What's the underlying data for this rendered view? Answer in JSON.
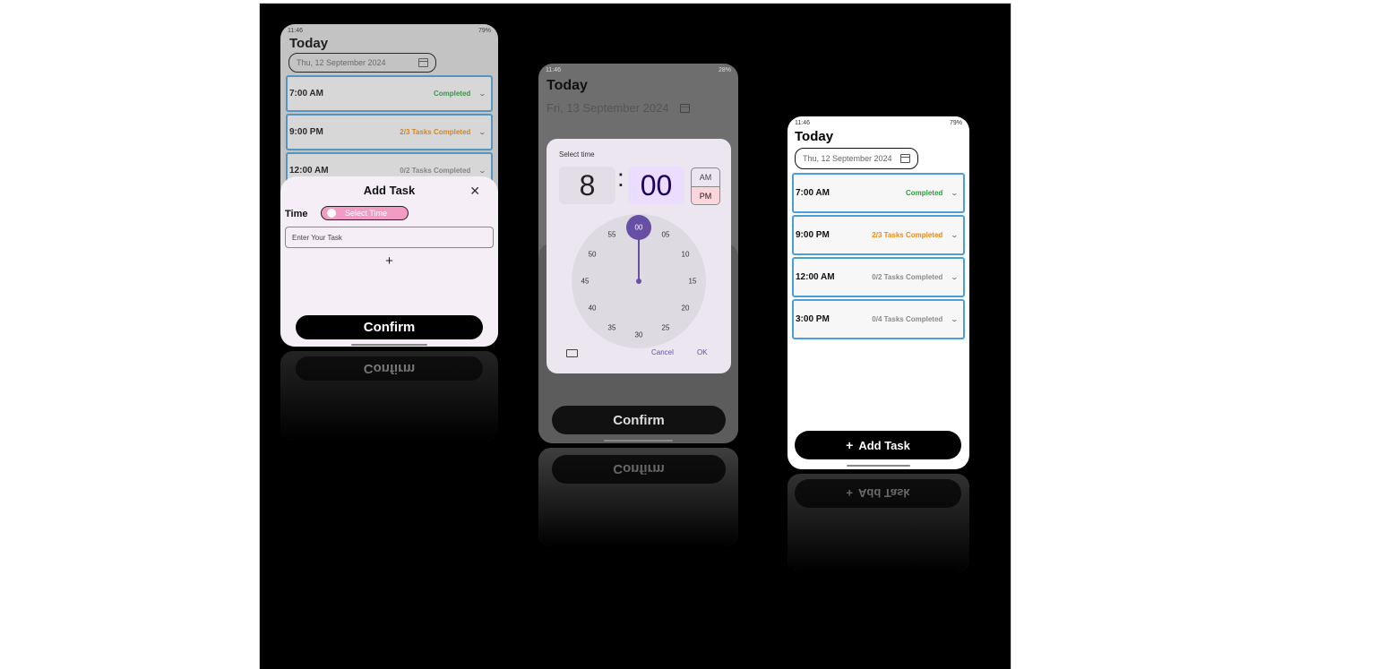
{
  "status": {
    "left_time": "11:46",
    "battery": "79%",
    "battery2": "28%"
  },
  "screen_title": "Today",
  "phone1": {
    "date": "Thu, 12 September 2024",
    "slots": [
      {
        "time": "7:00 AM",
        "status": "Completed",
        "color": "#2e9e3f"
      },
      {
        "time": "9:00 PM",
        "status": "2/3 Tasks Completed",
        "color": "#e98b12"
      },
      {
        "time": "12:00 AM",
        "status": "0/2 Tasks Completed",
        "color": "#8a8a8a"
      }
    ],
    "sheet": {
      "title": "Add Task",
      "time_label": "Time",
      "select_time": "Select Time",
      "task_placeholder": "Enter Your Task",
      "add_icon": "+",
      "confirm": "Confirm"
    }
  },
  "phone2": {
    "date": "Fri, 13 September 2024",
    "picker": {
      "title": "Select time",
      "hour": "8",
      "separator": ":",
      "minute": "00",
      "am": "AM",
      "pm": "PM",
      "selected_period": "PM",
      "dial_numbers": [
        "00",
        "05",
        "10",
        "15",
        "20",
        "25",
        "30",
        "35",
        "40",
        "45",
        "50",
        "55"
      ],
      "cancel": "Cancel",
      "ok": "OK",
      "keyboard_icon": "keyboard-icon"
    },
    "confirm": "Confirm"
  },
  "phone3": {
    "date": "Thu, 12 September 2024",
    "slots": [
      {
        "time": "7:00 AM",
        "status": "Completed",
        "color": "#2e9e3f"
      },
      {
        "time": "9:00 PM",
        "status": "2/3 Tasks Completed",
        "color": "#e98b12"
      },
      {
        "time": "12:00 AM",
        "status": "0/2 Tasks Completed",
        "color": "#8a8a8a"
      },
      {
        "time": "3:00 PM",
        "status": "0/4 Tasks Completed",
        "color": "#8a8a8a"
      }
    ],
    "add_task": "Add Task",
    "add_icon": "+"
  },
  "colors": {
    "slot_border": "#4a9fd8",
    "accent_purple": "#6750a4",
    "pill_pink": "#f29bc4",
    "pm_bg": "#f9d6dc"
  }
}
